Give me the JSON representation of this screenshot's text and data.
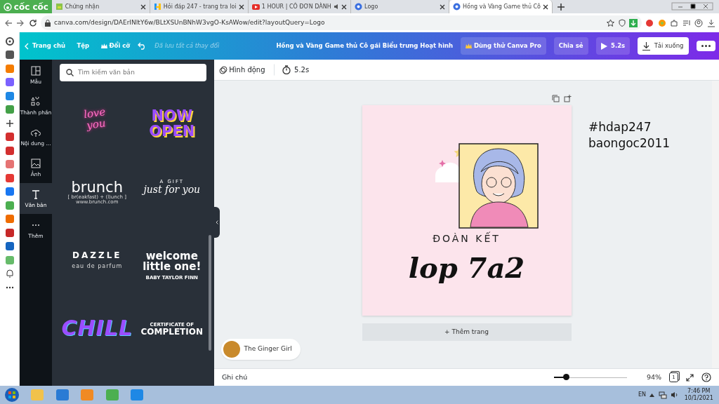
{
  "browser": {
    "brand": "cốc cốc",
    "tabs": [
      {
        "label": "Chứng nhận",
        "audio": false,
        "selected": false
      },
      {
        "label": "Hỏi đáp 247 - trang tra loi",
        "audio": false,
        "selected": false
      },
      {
        "label": "1 HOUR | CÔ ĐƠN DÀNH",
        "audio": true,
        "selected": false
      },
      {
        "label": "Logo",
        "audio": false,
        "selected": false
      },
      {
        "label": "Hồng và Vàng Game thủ Cô",
        "audio": false,
        "selected": true
      }
    ],
    "url": "canva.com/design/DAErINItY6w/BLtXSUnBNhW3vgO-KsAWow/edit?layoutQuery=Logo"
  },
  "topbar": {
    "home": "Trang chủ",
    "file": "Tệp",
    "resize": "Đổi cỡ",
    "save_status": "Đã lưu tất cả thay đổi",
    "title": "Hồng và Vàng Game thủ Cô gái Biểu trưng Hoạt hình",
    "pro": "Dùng thử Canva Pro",
    "share": "Chia sẻ",
    "play": "5.2s",
    "download": "Tải xuống"
  },
  "rail": [
    {
      "label": "Mẫu",
      "selected": false
    },
    {
      "label": "Thành phần",
      "selected": false
    },
    {
      "label": "Nội dung ...",
      "selected": false
    },
    {
      "label": "Ảnh",
      "selected": false
    },
    {
      "label": "Văn bản",
      "selected": true
    },
    {
      "label": "Thêm",
      "selected": false
    }
  ],
  "panel": {
    "search": {
      "placeholder": "Tìm kiếm văn bản"
    },
    "templates": [
      {
        "kind": "neon",
        "lines": [
          "love",
          "you"
        ]
      },
      {
        "kind": "bubble",
        "lines": [
          "NOW",
          "OPEN"
        ]
      },
      {
        "kind": "brunch",
        "lines": [
          "brunch",
          "[ br(eakfast) + (l)unch ]",
          "www.brunch.com"
        ]
      },
      {
        "kind": "gift",
        "lines": [
          "A GIFT",
          "just for you"
        ]
      },
      {
        "kind": "dazzle",
        "lines": [
          "DAZZLE",
          "eau de parfum"
        ]
      },
      {
        "kind": "welcome",
        "lines": [
          "welcome",
          "little one!",
          "BABY TAYLOR FINN"
        ]
      },
      {
        "kind": "chill",
        "lines": [
          "CHILL"
        ]
      },
      {
        "kind": "certificate",
        "lines": [
          "CERTIFICATE OF",
          "COMPLETION"
        ]
      }
    ]
  },
  "toolbar": {
    "animate": "Hình động",
    "duration": "5.2s"
  },
  "design": {
    "caption": "ĐOÀN KẾT",
    "script": "lop 7a2"
  },
  "note_lines": [
    "#hdap247",
    "baongoc2011"
  ],
  "add_page": "+ Thêm trang",
  "user_chip": "The Ginger Girl",
  "footer": {
    "notes": "Ghi chú",
    "zoom": {
      "level": 0.16
    },
    "zoom_value": "94%",
    "page_count": "1"
  },
  "taskbar": {
    "language": "EN",
    "time": "7:46 PM",
    "date": "10/1/2021"
  }
}
